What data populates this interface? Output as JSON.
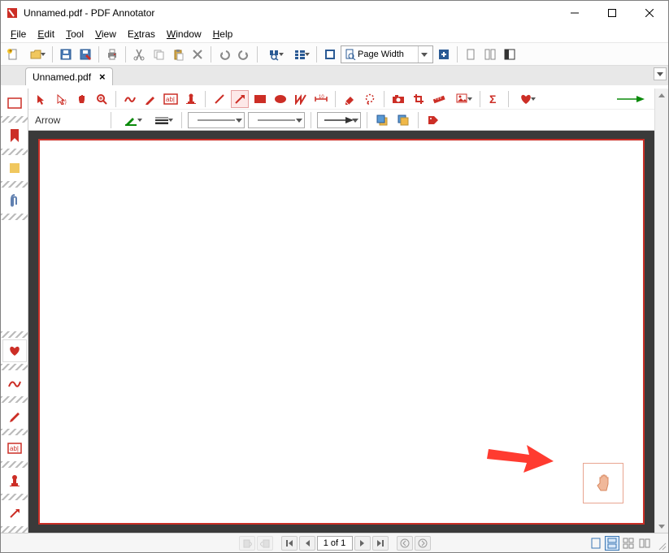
{
  "window": {
    "title": "Unnamed.pdf - PDF Annotator"
  },
  "menu": {
    "file": "File",
    "edit": "Edit",
    "tool": "Tool",
    "view": "View",
    "extras": "Extras",
    "window": "Window",
    "help": "Help"
  },
  "zoom": {
    "label": "Page Width"
  },
  "tab": {
    "name": "Unnamed.pdf"
  },
  "tool": {
    "current": "Arrow"
  },
  "status": {
    "page": "1 of 1"
  }
}
